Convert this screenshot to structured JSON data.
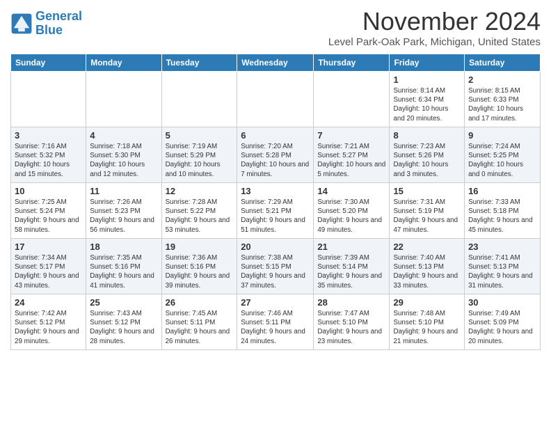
{
  "header": {
    "logo_line1": "General",
    "logo_line2": "Blue",
    "month_title": "November 2024",
    "location": "Level Park-Oak Park, Michigan, United States"
  },
  "days_of_week": [
    "Sunday",
    "Monday",
    "Tuesday",
    "Wednesday",
    "Thursday",
    "Friday",
    "Saturday"
  ],
  "weeks": [
    [
      {
        "day": "",
        "info": ""
      },
      {
        "day": "",
        "info": ""
      },
      {
        "day": "",
        "info": ""
      },
      {
        "day": "",
        "info": ""
      },
      {
        "day": "",
        "info": ""
      },
      {
        "day": "1",
        "info": "Sunrise: 8:14 AM\nSunset: 6:34 PM\nDaylight: 10 hours and 20 minutes."
      },
      {
        "day": "2",
        "info": "Sunrise: 8:15 AM\nSunset: 6:33 PM\nDaylight: 10 hours and 17 minutes."
      }
    ],
    [
      {
        "day": "3",
        "info": "Sunrise: 7:16 AM\nSunset: 5:32 PM\nDaylight: 10 hours and 15 minutes."
      },
      {
        "day": "4",
        "info": "Sunrise: 7:18 AM\nSunset: 5:30 PM\nDaylight: 10 hours and 12 minutes."
      },
      {
        "day": "5",
        "info": "Sunrise: 7:19 AM\nSunset: 5:29 PM\nDaylight: 10 hours and 10 minutes."
      },
      {
        "day": "6",
        "info": "Sunrise: 7:20 AM\nSunset: 5:28 PM\nDaylight: 10 hours and 7 minutes."
      },
      {
        "day": "7",
        "info": "Sunrise: 7:21 AM\nSunset: 5:27 PM\nDaylight: 10 hours and 5 minutes."
      },
      {
        "day": "8",
        "info": "Sunrise: 7:23 AM\nSunset: 5:26 PM\nDaylight: 10 hours and 3 minutes."
      },
      {
        "day": "9",
        "info": "Sunrise: 7:24 AM\nSunset: 5:25 PM\nDaylight: 10 hours and 0 minutes."
      }
    ],
    [
      {
        "day": "10",
        "info": "Sunrise: 7:25 AM\nSunset: 5:24 PM\nDaylight: 9 hours and 58 minutes."
      },
      {
        "day": "11",
        "info": "Sunrise: 7:26 AM\nSunset: 5:23 PM\nDaylight: 9 hours and 56 minutes."
      },
      {
        "day": "12",
        "info": "Sunrise: 7:28 AM\nSunset: 5:22 PM\nDaylight: 9 hours and 53 minutes."
      },
      {
        "day": "13",
        "info": "Sunrise: 7:29 AM\nSunset: 5:21 PM\nDaylight: 9 hours and 51 minutes."
      },
      {
        "day": "14",
        "info": "Sunrise: 7:30 AM\nSunset: 5:20 PM\nDaylight: 9 hours and 49 minutes."
      },
      {
        "day": "15",
        "info": "Sunrise: 7:31 AM\nSunset: 5:19 PM\nDaylight: 9 hours and 47 minutes."
      },
      {
        "day": "16",
        "info": "Sunrise: 7:33 AM\nSunset: 5:18 PM\nDaylight: 9 hours and 45 minutes."
      }
    ],
    [
      {
        "day": "17",
        "info": "Sunrise: 7:34 AM\nSunset: 5:17 PM\nDaylight: 9 hours and 43 minutes."
      },
      {
        "day": "18",
        "info": "Sunrise: 7:35 AM\nSunset: 5:16 PM\nDaylight: 9 hours and 41 minutes."
      },
      {
        "day": "19",
        "info": "Sunrise: 7:36 AM\nSunset: 5:16 PM\nDaylight: 9 hours and 39 minutes."
      },
      {
        "day": "20",
        "info": "Sunrise: 7:38 AM\nSunset: 5:15 PM\nDaylight: 9 hours and 37 minutes."
      },
      {
        "day": "21",
        "info": "Sunrise: 7:39 AM\nSunset: 5:14 PM\nDaylight: 9 hours and 35 minutes."
      },
      {
        "day": "22",
        "info": "Sunrise: 7:40 AM\nSunset: 5:13 PM\nDaylight: 9 hours and 33 minutes."
      },
      {
        "day": "23",
        "info": "Sunrise: 7:41 AM\nSunset: 5:13 PM\nDaylight: 9 hours and 31 minutes."
      }
    ],
    [
      {
        "day": "24",
        "info": "Sunrise: 7:42 AM\nSunset: 5:12 PM\nDaylight: 9 hours and 29 minutes."
      },
      {
        "day": "25",
        "info": "Sunrise: 7:43 AM\nSunset: 5:12 PM\nDaylight: 9 hours and 28 minutes."
      },
      {
        "day": "26",
        "info": "Sunrise: 7:45 AM\nSunset: 5:11 PM\nDaylight: 9 hours and 26 minutes."
      },
      {
        "day": "27",
        "info": "Sunrise: 7:46 AM\nSunset: 5:11 PM\nDaylight: 9 hours and 24 minutes."
      },
      {
        "day": "28",
        "info": "Sunrise: 7:47 AM\nSunset: 5:10 PM\nDaylight: 9 hours and 23 minutes."
      },
      {
        "day": "29",
        "info": "Sunrise: 7:48 AM\nSunset: 5:10 PM\nDaylight: 9 hours and 21 minutes."
      },
      {
        "day": "30",
        "info": "Sunrise: 7:49 AM\nSunset: 5:09 PM\nDaylight: 9 hours and 20 minutes."
      }
    ]
  ]
}
